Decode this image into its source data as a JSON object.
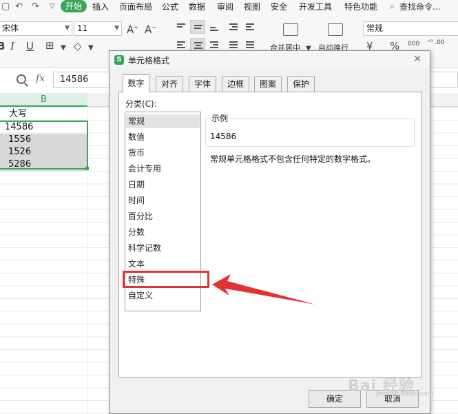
{
  "menubar": {
    "items": [
      "开始",
      "插入",
      "页面布局",
      "公式",
      "数据",
      "审阅",
      "视图",
      "安全",
      "开发工具",
      "特色功能"
    ],
    "search_label": "查找命令..."
  },
  "ribbon": {
    "font_name": "宋体",
    "font_size": "11",
    "merge_label": "合并居中",
    "wrap_label": "自动换行",
    "number_format": "常规"
  },
  "formula_bar": {
    "fx": "fx",
    "value": "14586"
  },
  "sheet": {
    "column_b": "B",
    "cells": [
      "大写",
      "14586",
      "1556",
      "1526",
      "5286"
    ]
  },
  "dialog": {
    "title": "单元格格式",
    "close_glyph": "✕",
    "tabs": [
      "数字",
      "对齐",
      "字体",
      "边框",
      "图案",
      "保护"
    ],
    "active_tab": "数字",
    "category_label": "分类(C):",
    "categories": [
      "常规",
      "数值",
      "货币",
      "会计专用",
      "日期",
      "时间",
      "百分比",
      "分数",
      "科学记数",
      "文本",
      "特殊",
      "自定义"
    ],
    "selected_category": "常规",
    "sample_legend": "示例",
    "sample_value": "14586",
    "general_description": "常规单元格格式不包含任何特定的数字格式。",
    "ok_label": "确定",
    "cancel_label": "取消"
  },
  "annotation": {
    "highlighted_category": "特殊",
    "color": "#e23232"
  },
  "watermark": {
    "main": "Bai 经验",
    "sub": "jingyan.baidu.com"
  },
  "colors": {
    "accent": "#3aa55a",
    "annotation": "#e23232"
  }
}
